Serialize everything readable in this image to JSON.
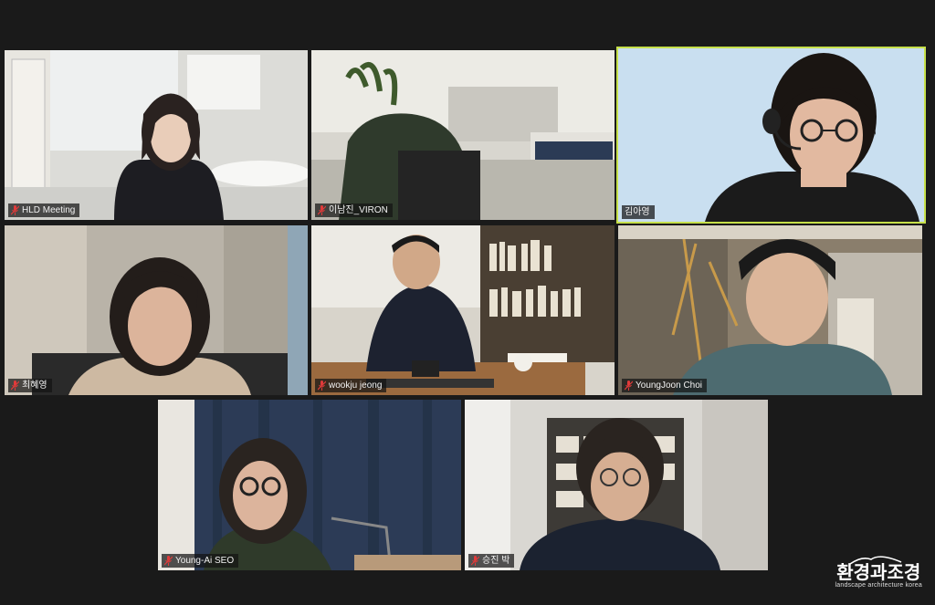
{
  "participants": [
    {
      "name": "HLD Meeting",
      "muted": true
    },
    {
      "name": "이남진_VIRON",
      "muted": true
    },
    {
      "name": "김아영",
      "muted": false,
      "speaking": true
    },
    {
      "name": "최혜영",
      "muted": true
    },
    {
      "name": "wookju jeong",
      "muted": true
    },
    {
      "name": "YoungJoon Choi",
      "muted": true
    },
    {
      "name": "Young-Ai SEO",
      "muted": true
    },
    {
      "name": "승진 박",
      "muted": true
    }
  ],
  "watermark": {
    "title": "환경과조경",
    "subtitle": "landscape architecture korea"
  },
  "colors": {
    "active_speaker_border": "#c6e04a",
    "muted_icon": "#e03a3a",
    "background": "#1a1a1a"
  }
}
